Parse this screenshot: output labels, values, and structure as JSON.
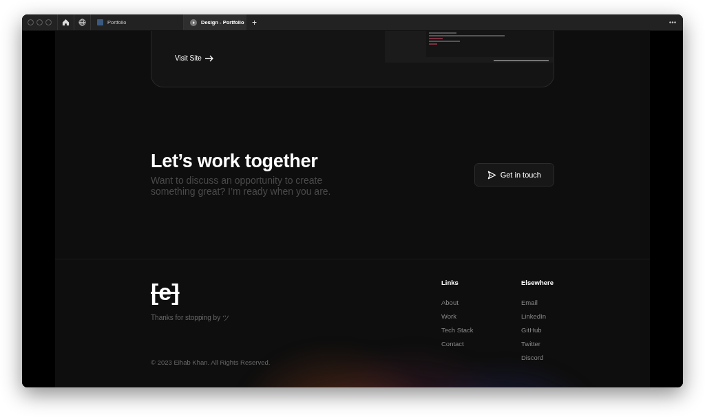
{
  "browser": {
    "tabs": [
      {
        "title": "Portfolio",
        "kind": "page",
        "selected": false
      },
      {
        "title": "Design - Portfolio",
        "kind": "media",
        "selected": true
      }
    ],
    "new_tab": "+"
  },
  "project_card": {
    "link": "Visit Site"
  },
  "cta": {
    "heading": "Let’s work together",
    "text": "Want to discuss an opportunity to create something great? I’m ready when you are.",
    "button": "Get in touch"
  },
  "footer": {
    "logo": "[e]",
    "tagline": "Thanks for stopping by ツ",
    "copyright": "© 2023 Eihab Khan. All Rights Reserved.",
    "columns": [
      {
        "title": "Links",
        "items": [
          "About",
          "Work",
          "Tech Stack",
          "Contact"
        ]
      },
      {
        "title": "Elsewhere",
        "items": [
          "Email",
          "LinkedIn",
          "GitHub",
          "Twitter",
          "Discord"
        ]
      }
    ]
  }
}
